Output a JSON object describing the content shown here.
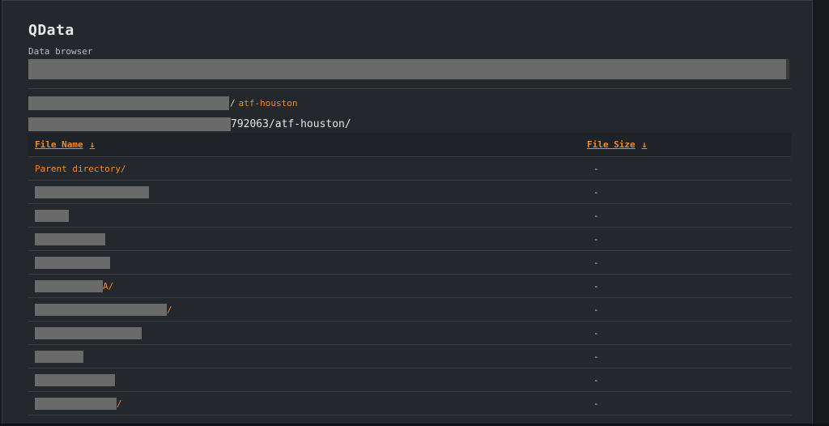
{
  "app": {
    "title": "QData",
    "subtitle": "Data browser"
  },
  "breadcrumb": {
    "separator": "/",
    "current": "atf-houston"
  },
  "path": {
    "suffix": "792063/atf-houston/"
  },
  "table": {
    "headers": {
      "name": "File Name",
      "size": "File Size",
      "sort_arrow": "↓"
    },
    "rows": [
      {
        "name": "Parent directory/",
        "size": "-"
      },
      {
        "name": "",
        "size": "-"
      },
      {
        "name": "",
        "size": "-"
      },
      {
        "name": "",
        "size": "-"
      },
      {
        "name": "",
        "size": "-"
      },
      {
        "name": "A/",
        "size": "-"
      },
      {
        "name": "/",
        "size": "-"
      },
      {
        "name": "",
        "size": "-"
      },
      {
        "name": "",
        "size": "-"
      },
      {
        "name": "",
        "size": "-"
      },
      {
        "name": "/",
        "size": "-"
      }
    ]
  },
  "colors": {
    "accent": "#f08a2c",
    "panel": "#24272b",
    "background": "#17191c",
    "redaction": "#6a6a6a"
  }
}
